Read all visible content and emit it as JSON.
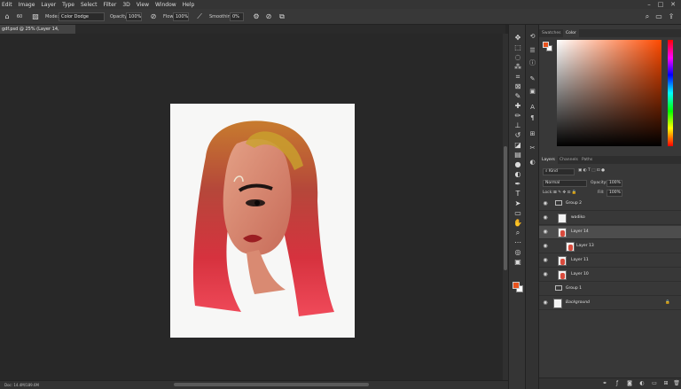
{
  "menu": [
    "Edit",
    "Image",
    "Layer",
    "Type",
    "Select",
    "Filter",
    "3D",
    "View",
    "Window",
    "Help"
  ],
  "window_controls": {
    "minimize": "–",
    "maximize": "□",
    "close": "✕"
  },
  "options": {
    "mode_label": "Mode:",
    "mode_value": "Color Dodge",
    "opacity_label": "Opacity:",
    "opacity_value": "100%",
    "flow_label": "Flow:",
    "flow_value": "100%",
    "smoothing_label": "Smoothing:",
    "smoothing_value": "0%",
    "brush_size": "60"
  },
  "document_tab": {
    "title": "gdf.psd @ 25% (Layer 14, RGB/8) *",
    "close": "×"
  },
  "status": {
    "doc_info": "Doc: 14.4M/189.6M"
  },
  "tools": [
    {
      "name": "move-tool",
      "glyph": "✥"
    },
    {
      "name": "marquee-tool",
      "glyph": "⬚"
    },
    {
      "name": "lasso-tool",
      "glyph": "◌"
    },
    {
      "name": "quick-select-tool",
      "glyph": "⁂"
    },
    {
      "name": "crop-tool",
      "glyph": "⌗"
    },
    {
      "name": "frame-tool",
      "glyph": "⊠"
    },
    {
      "name": "eyedropper-tool",
      "glyph": "✎"
    },
    {
      "name": "healing-tool",
      "glyph": "✚"
    },
    {
      "name": "brush-tool",
      "glyph": "✏"
    },
    {
      "name": "clone-stamp-tool",
      "glyph": "⊥"
    },
    {
      "name": "history-brush-tool",
      "glyph": "↺"
    },
    {
      "name": "eraser-tool",
      "glyph": "◪"
    },
    {
      "name": "gradient-tool",
      "glyph": "▤"
    },
    {
      "name": "blur-tool",
      "glyph": "●"
    },
    {
      "name": "dodge-tool",
      "glyph": "◐"
    },
    {
      "name": "pen-tool",
      "glyph": "✒"
    },
    {
      "name": "type-tool",
      "glyph": "T"
    },
    {
      "name": "path-select-tool",
      "glyph": "➤"
    },
    {
      "name": "shape-tool",
      "glyph": "▭"
    },
    {
      "name": "hand-tool",
      "glyph": "✋"
    },
    {
      "name": "zoom-tool",
      "glyph": "⌕"
    },
    {
      "name": "edit-toolbar",
      "glyph": "⋯"
    },
    {
      "name": "quick-mask",
      "glyph": "◎"
    },
    {
      "name": "screen-mode",
      "glyph": "▣"
    }
  ],
  "colors": {
    "foreground": "#e8531e",
    "background": "#ffffff",
    "accent": "#e8531e"
  },
  "panels": {
    "swatches_tab": "Swatches",
    "color_tab": "Color",
    "layers_tab": "Layers",
    "channels_tab": "Channels",
    "paths_tab": "Paths"
  },
  "layers_panel": {
    "filter_kind": "Kind",
    "blend_mode": "Normal",
    "opacity_label": "Opacity:",
    "opacity_value": "100%",
    "lock_label": "Lock:",
    "fill_label": "Fill:",
    "fill_value": "100%",
    "layers": [
      {
        "name": "Group 2",
        "type": "group",
        "visible": true
      },
      {
        "name": "wadiko",
        "type": "smart",
        "visible": true
      },
      {
        "name": "Layer 14",
        "type": "layer",
        "visible": true,
        "selected": true
      },
      {
        "name": "Layer 13",
        "type": "layer",
        "visible": true,
        "clipped": true
      },
      {
        "name": "Layer 11",
        "type": "layer",
        "visible": true
      },
      {
        "name": "Layer 10",
        "type": "layer",
        "visible": true
      },
      {
        "name": "Group 1",
        "type": "group",
        "visible": false
      },
      {
        "name": "Background",
        "type": "background",
        "visible": true
      }
    ]
  }
}
